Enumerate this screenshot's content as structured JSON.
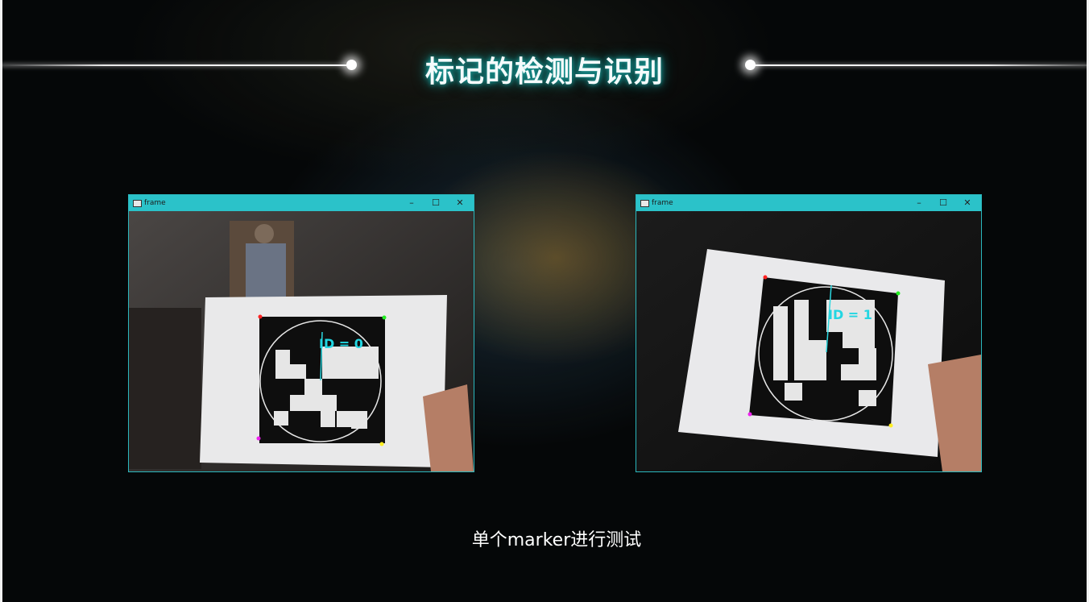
{
  "slide": {
    "title": "标记的检测与识别",
    "caption": "单个marker进行测试",
    "accent_color": "#2bc2c9"
  },
  "windows": [
    {
      "title": "frame",
      "icon": "app-window-icon",
      "controls": [
        "–",
        "☐",
        "✕"
      ],
      "overlay_text": "ID = 0"
    },
    {
      "title": "frame",
      "icon": "app-window-icon",
      "controls": [
        "–",
        "☐",
        "✕"
      ],
      "overlay_text": "ID = 1"
    }
  ]
}
